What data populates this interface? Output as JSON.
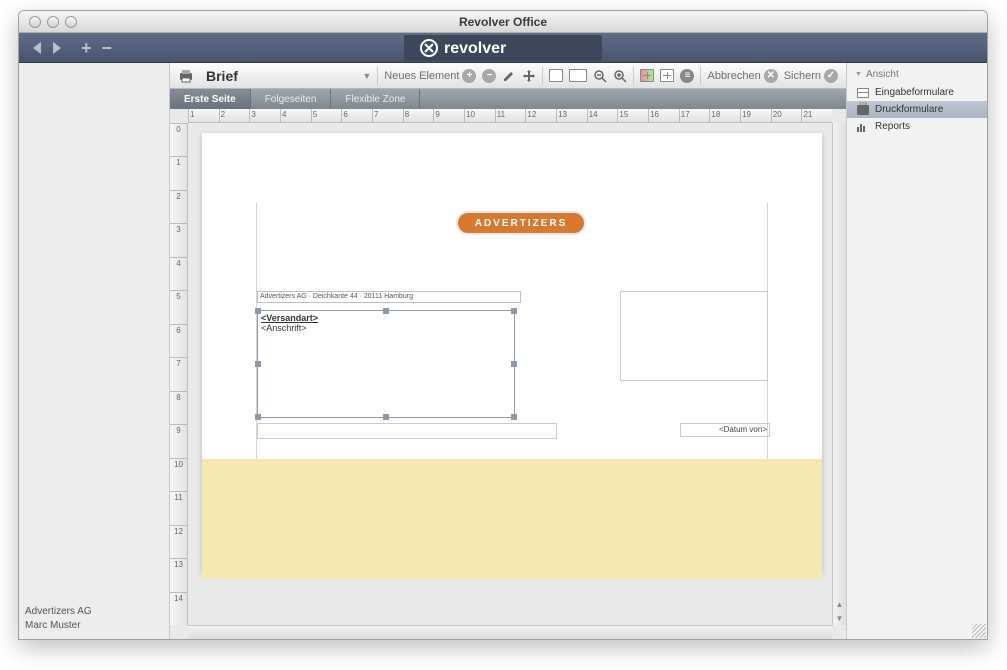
{
  "window": {
    "title": "Revolver Office"
  },
  "brand": {
    "name": "revolver"
  },
  "toolbar": {
    "doc_title": "Brief",
    "new_element": "Neues Element",
    "cancel": "Abbrechen",
    "save": "Sichern"
  },
  "tabs": {
    "first_page": "Erste Seite",
    "following": "Folgeseiten",
    "flexible": "Flexible Zone"
  },
  "ruler_h": [
    "1",
    "2",
    "3",
    "4",
    "5",
    "6",
    "7",
    "8",
    "9",
    "10",
    "11",
    "12",
    "13",
    "14",
    "15",
    "16",
    "17",
    "18",
    "19",
    "20",
    "21"
  ],
  "ruler_v": [
    "0",
    "1",
    "2",
    "3",
    "4",
    "5",
    "6",
    "7",
    "8",
    "9",
    "10",
    "11",
    "12",
    "13",
    "14"
  ],
  "document": {
    "logo_text": "ADVERTIZERS",
    "sender_line": "Advertizers AG · Deichkante 44 · 20111 Hamburg",
    "field_versandart": "<Versandart>",
    "field_anschrift": "<Anschrift>",
    "field_datum": "<Datum von>"
  },
  "right_panel": {
    "header": "Ansicht",
    "items": {
      "eingabe": "Eingabeformulare",
      "druck": "Druckformulare",
      "reports": "Reports"
    }
  },
  "footer": {
    "company": "Advertizers AG",
    "user": "Marc Muster"
  }
}
